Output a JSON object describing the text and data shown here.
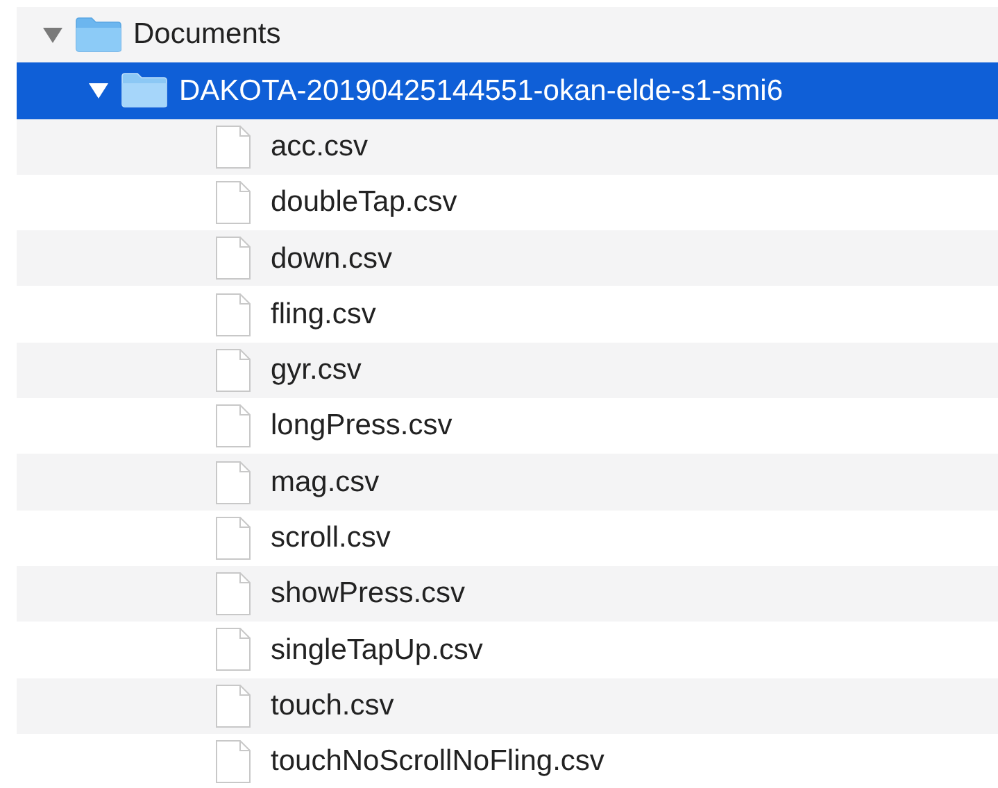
{
  "tree": [
    {
      "name": "Documents",
      "kind": "folder",
      "expanded": true,
      "selected": false,
      "children": [
        {
          "name": "DAKOTA-20190425144551-okan-elde-s1-smi6",
          "kind": "folder",
          "expanded": true,
          "selected": true,
          "children": [
            {
              "name": "acc.csv",
              "kind": "file",
              "selected": false
            },
            {
              "name": "doubleTap.csv",
              "kind": "file",
              "selected": false
            },
            {
              "name": "down.csv",
              "kind": "file",
              "selected": false
            },
            {
              "name": "fling.csv",
              "kind": "file",
              "selected": false
            },
            {
              "name": "gyr.csv",
              "kind": "file",
              "selected": false
            },
            {
              "name": "longPress.csv",
              "kind": "file",
              "selected": false
            },
            {
              "name": "mag.csv",
              "kind": "file",
              "selected": false
            },
            {
              "name": "scroll.csv",
              "kind": "file",
              "selected": false
            },
            {
              "name": "showPress.csv",
              "kind": "file",
              "selected": false
            },
            {
              "name": "singleTapUp.csv",
              "kind": "file",
              "selected": false
            },
            {
              "name": "touch.csv",
              "kind": "file",
              "selected": false
            },
            {
              "name": "touchNoScrollNoFling.csv",
              "kind": "file",
              "selected": false
            }
          ]
        }
      ]
    }
  ]
}
